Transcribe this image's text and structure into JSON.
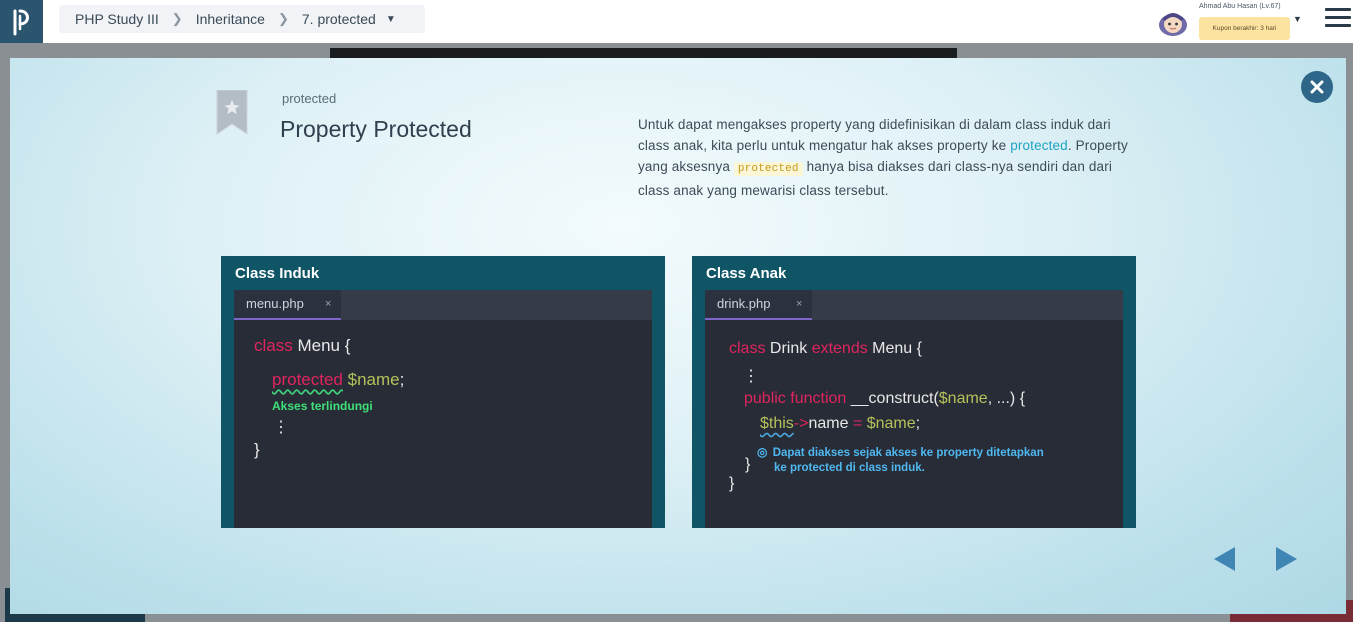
{
  "header": {
    "breadcrumb": [
      "PHP Study III",
      "Inheritance",
      "7. protected"
    ],
    "username": "Ahmad Abu Hasan (Lv.67)",
    "coupon": "Kupon berakhir: 3 hari"
  },
  "slide": {
    "subtitle": "protected",
    "title": "Property Protected",
    "desc": {
      "p1": "Untuk dapat mengakses property yang didefinisikan di dalam class induk dari class anak, kita perlu untuk mengatur hak akses property ke ",
      "link": "protected",
      "p2": ". Property yang aksesnya ",
      "code": "protected",
      "p3": " hanya bisa diakses dari class-nya sendiri dan dari class anak yang mewarisi class tersebut."
    }
  },
  "panels": {
    "left": {
      "title": "Class Induk",
      "tab": "menu.php",
      "tab_close": "×",
      "l1_kw": "class",
      "l1_rest": " Menu {",
      "l2_kw": "protected",
      "l2_var": " $name",
      "l2_end": ";",
      "note": "Akses terlindungi",
      "dots": "⋮",
      "close": "}"
    },
    "right": {
      "title": "Class Anak",
      "tab": "drink.php",
      "tab_close": "×",
      "l1_kw": "class",
      "l1_a": " Drink ",
      "l1_kw2": "extends",
      "l1_b": " Menu {",
      "dots": "⋮",
      "l3_kw": "public function",
      "l3_a": " __construct(",
      "l3_var": "$name",
      "l3_b": ", ...) {",
      "l4_var": "$this",
      "l4_arrow": "->",
      "l4_a": "name ",
      "l4_eq": "=",
      "l4_var2": " $name",
      "l4_end": ";",
      "note_icon": "◎",
      "note1": "Dapat diakses sejak akses ke property ditetapkan",
      "note2": "ke protected di class induk.",
      "close_inner": "}",
      "close_outer": "}"
    }
  },
  "colors": {
    "accent": "#2d6688",
    "panel": "#0f5566",
    "editor": "#282c36",
    "keyword": "#e0245e",
    "variable": "#b4c25a"
  }
}
